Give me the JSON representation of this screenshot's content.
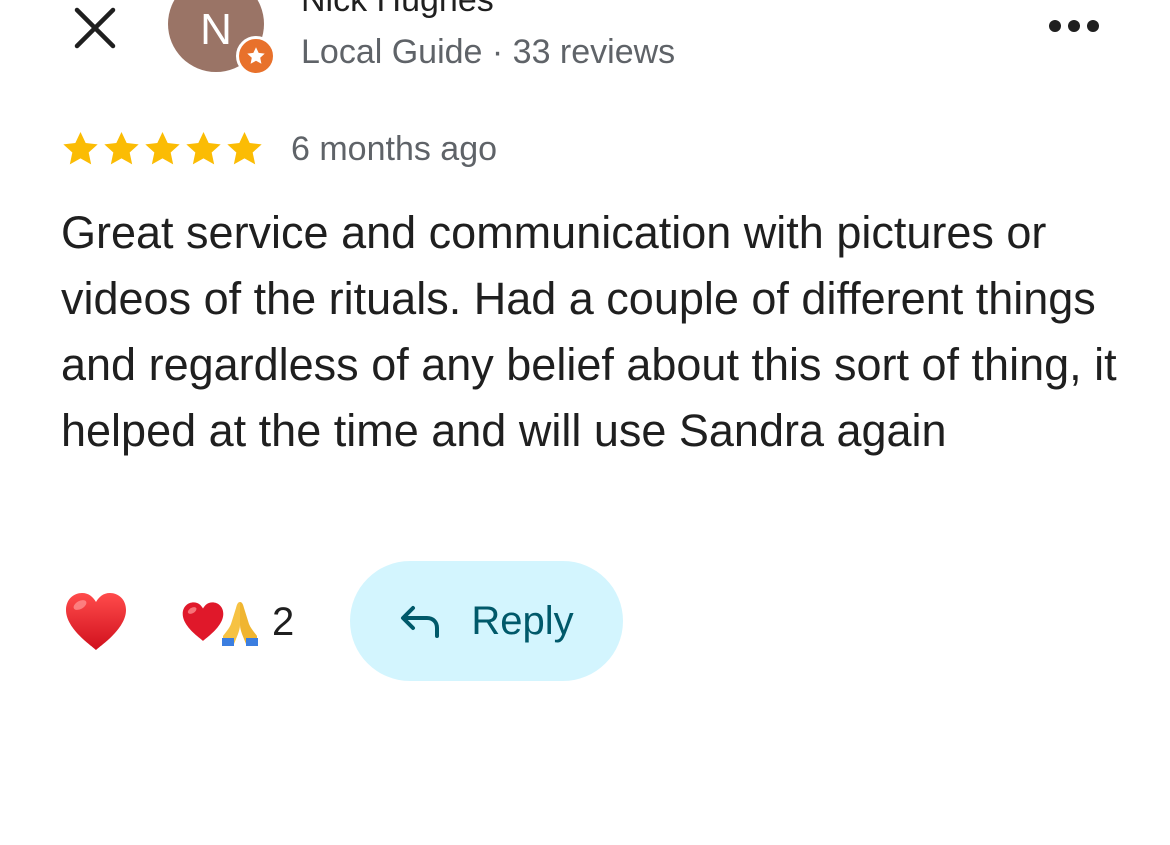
{
  "header": {
    "close_icon": "close-icon",
    "more_icon": "more-horizontal-icon"
  },
  "author": {
    "avatar_letter": "N",
    "avatar_color": "#9a7466",
    "badge_icon": "local-guide-star-icon",
    "badge_color": "#e8712b",
    "name": "Nick Hughes",
    "meta": "Local Guide · 33 reviews"
  },
  "review": {
    "rating": 5,
    "rating_max": 5,
    "star_color": "#fbbc04",
    "time_ago": "6 months ago",
    "text": "Great service and communication with pictures or videos of the rituals. Had a couple of different things and regardless of any belief about this sort of thing, it helped at the time and will use Sandra again"
  },
  "reactions": {
    "react_button_icon": "heart-icon",
    "summary_icons": [
      "heart-icon",
      "folded-hands-icon"
    ],
    "count": "2"
  },
  "reply": {
    "icon": "reply-arrow-icon",
    "label": "Reply",
    "background": "#d3f5fe",
    "text_color": "#00596a"
  }
}
